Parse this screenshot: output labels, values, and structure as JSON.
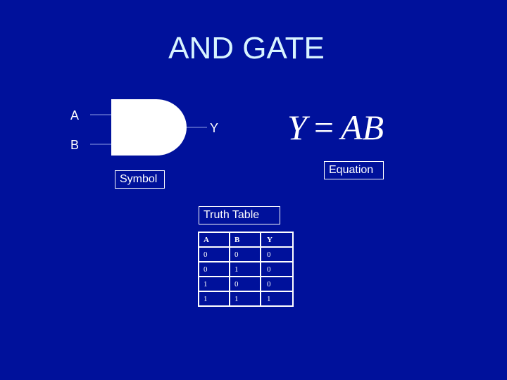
{
  "title": "AND GATE",
  "symbol": {
    "inputs": [
      "A",
      "B"
    ],
    "output": "Y",
    "label": "Symbol",
    "gate_color": "#ffffff",
    "wire_color": "#8fa0e6"
  },
  "equation": {
    "lhs": "Y",
    "operator": "=",
    "rhs": "AB",
    "label": "Equation"
  },
  "truth_table": {
    "label": "Truth Table",
    "headers": [
      "A",
      "B",
      "Y"
    ],
    "rows": [
      [
        "0",
        "0",
        "0"
      ],
      [
        "0",
        "1",
        "0"
      ],
      [
        "1",
        "0",
        "0"
      ],
      [
        "1",
        "1",
        "1"
      ]
    ]
  },
  "colors": {
    "background": "#00119b",
    "title": "#d8f4ff",
    "text": "#ffffff"
  }
}
